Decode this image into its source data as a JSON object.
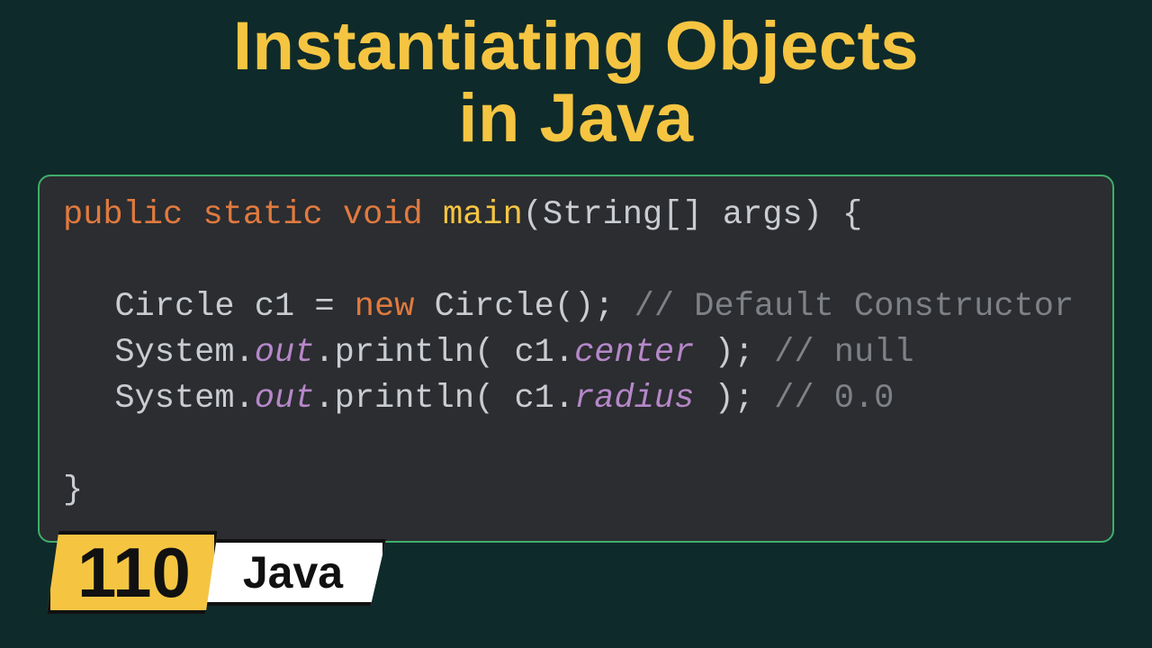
{
  "title_line1": "Instantiating Objects",
  "title_line2": "in Java",
  "badge_number": "110",
  "badge_lang": "Java",
  "code": {
    "kw_public": "public",
    "kw_static": "static",
    "kw_void": "void",
    "fn_main": "main",
    "sig_rest": "(String[] args) {",
    "l1_pre": "Circle c1 = ",
    "kw_new": "new",
    "l1_post": " Circle(); ",
    "l1_cm": "// Default Constructor",
    "l2_sys": "System.",
    "field_out": "out",
    "l2_mid": ".println( c1.",
    "field_center": "center",
    "l2_post": " ); ",
    "l2_cm": "// null",
    "l3_sys": "System.",
    "l3_mid": ".println( c1.",
    "field_radius": "radius",
    "l3_post": " ); ",
    "l3_cm": "// 0.0",
    "close_brace": "}"
  }
}
